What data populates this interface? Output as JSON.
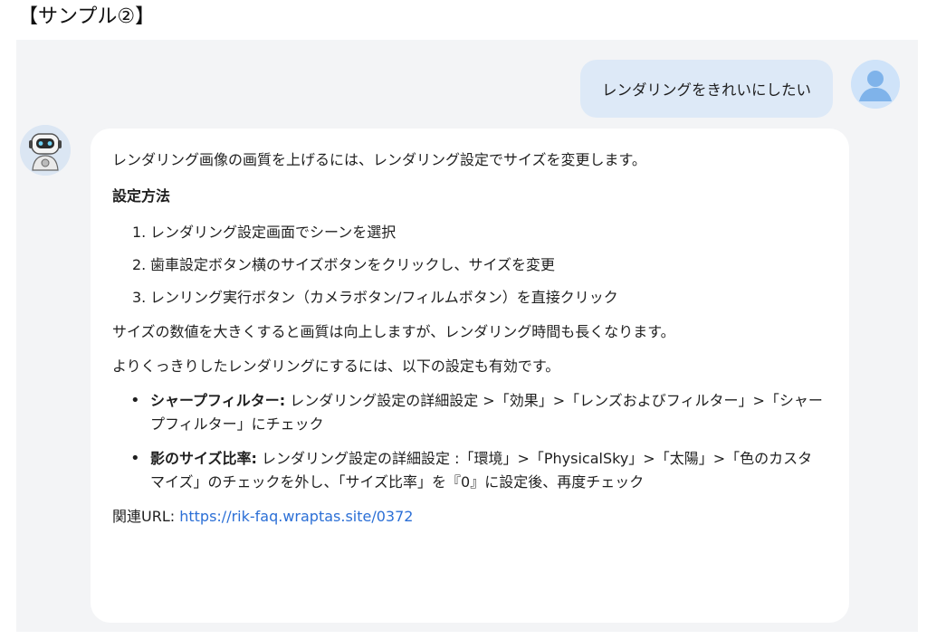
{
  "heading": "【サンプル②】",
  "user_message": "レンダリングをきれいにしたい",
  "bot": {
    "intro": "レンダリング画像の画質を上げるには、レンダリング設定でサイズを変更します。",
    "section_title": "設定方法",
    "steps": [
      {
        "num": "1.",
        "text": "レンダリング設定画面でシーンを選択"
      },
      {
        "num": "2.",
        "text": "歯車設定ボタン横のサイズボタンをクリックし、サイズを変更"
      },
      {
        "num": "3.",
        "text": "レンリング実行ボタン（カメラボタン/フィルムボタン）を直接クリック"
      }
    ],
    "note": "サイズの数値を大きくすると画質は向上しますが、レンダリング時間も長くなります。",
    "extra_intro": "よりくっきりしたレンダリングにするには、以下の設定も有効です。",
    "bullets": [
      {
        "label": "シャープフィルター:",
        "text": " レンダリング設定の詳細設定 >「効果」>「レンズおよびフィルター」>「シャープフィルター」にチェック"
      },
      {
        "label": "影のサイズ比率:",
        "text": " レンダリング設定の詳細設定 :「環境」>「PhysicalSky」>「太陽」>「色のカスタマイズ」のチェックを外し、「サイズ比率」を『0』に設定後、再度チェック"
      }
    ],
    "related_label": "関連URL: ",
    "related_url": "https://rik-faq.wraptas.site/0372"
  },
  "icons": {
    "user_avatar": "user-avatar-icon",
    "bot_avatar": "robot-avatar-icon"
  },
  "colors": {
    "panel_bg": "#f3f4f6",
    "user_bubble": "#dde9f7",
    "link": "#2b6fd6"
  }
}
